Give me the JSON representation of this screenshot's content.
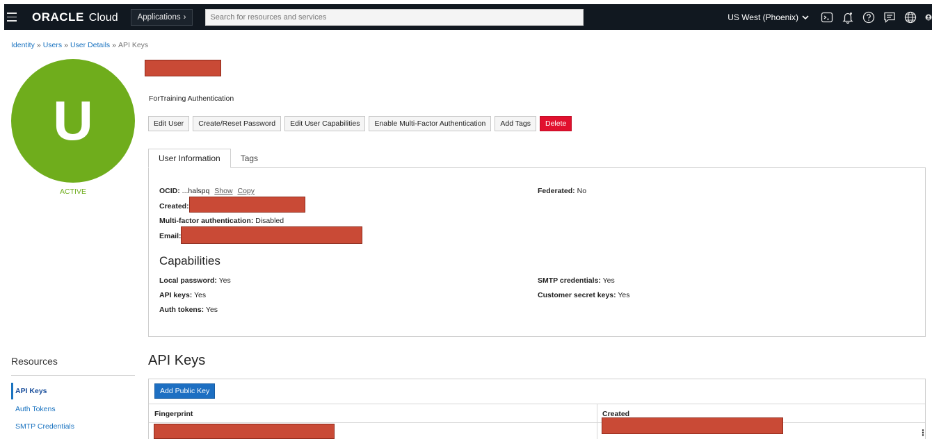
{
  "topbar": {
    "brand": "ORACLE",
    "product": "Cloud",
    "apps_label": "Applications",
    "apps_chevron": "›",
    "search_placeholder": "Search for resources and services",
    "region": "US West (Phoenix)",
    "icons": [
      "cloud-shell-icon",
      "bell-icon",
      "help-icon",
      "chat-icon",
      "globe-icon"
    ]
  },
  "breadcrumb": {
    "items": [
      "Identity",
      "Users",
      "User Details"
    ],
    "current": "API Keys",
    "separator": "»"
  },
  "user": {
    "initial": "U",
    "status": "ACTIVE",
    "description": "ForTraining Authentication",
    "avatar_color": "#6fad1c"
  },
  "actions": {
    "edit_user": "Edit User",
    "reset_password": "Create/Reset Password",
    "edit_capabilities": "Edit User Capabilities",
    "enable_mfa": "Enable Multi-Factor Authentication",
    "add_tags": "Add Tags",
    "delete": "Delete"
  },
  "tabs": {
    "user_info": "User Information",
    "tags": "Tags"
  },
  "info": {
    "ocid_label": "OCID:",
    "ocid_value": "...halspq",
    "show": "Show",
    "copy": "Copy",
    "created_label": "Created:",
    "mfa_label": "Multi-factor authentication:",
    "mfa_value": "Disabled",
    "email_label": "Email:",
    "federated_label": "Federated:",
    "federated_value": "No"
  },
  "capabilities": {
    "title": "Capabilities",
    "local_password_label": "Local password:",
    "local_password_value": "Yes",
    "api_keys_label": "API keys:",
    "api_keys_value": "Yes",
    "auth_tokens_label": "Auth tokens:",
    "auth_tokens_value": "Yes",
    "smtp_label": "SMTP credentials:",
    "smtp_value": "Yes",
    "customer_secret_label": "Customer secret keys:",
    "customer_secret_value": "Yes"
  },
  "resources": {
    "title": "Resources",
    "items": [
      "API Keys",
      "Auth Tokens",
      "SMTP Credentials"
    ]
  },
  "api_keys": {
    "title": "API Keys",
    "add_button": "Add Public Key",
    "columns": [
      "Fingerprint",
      "Created"
    ]
  },
  "colors": {
    "topbar": "#111820",
    "accent": "#1a73c0",
    "danger": "#e1102e",
    "redaction": "#c94a36"
  }
}
